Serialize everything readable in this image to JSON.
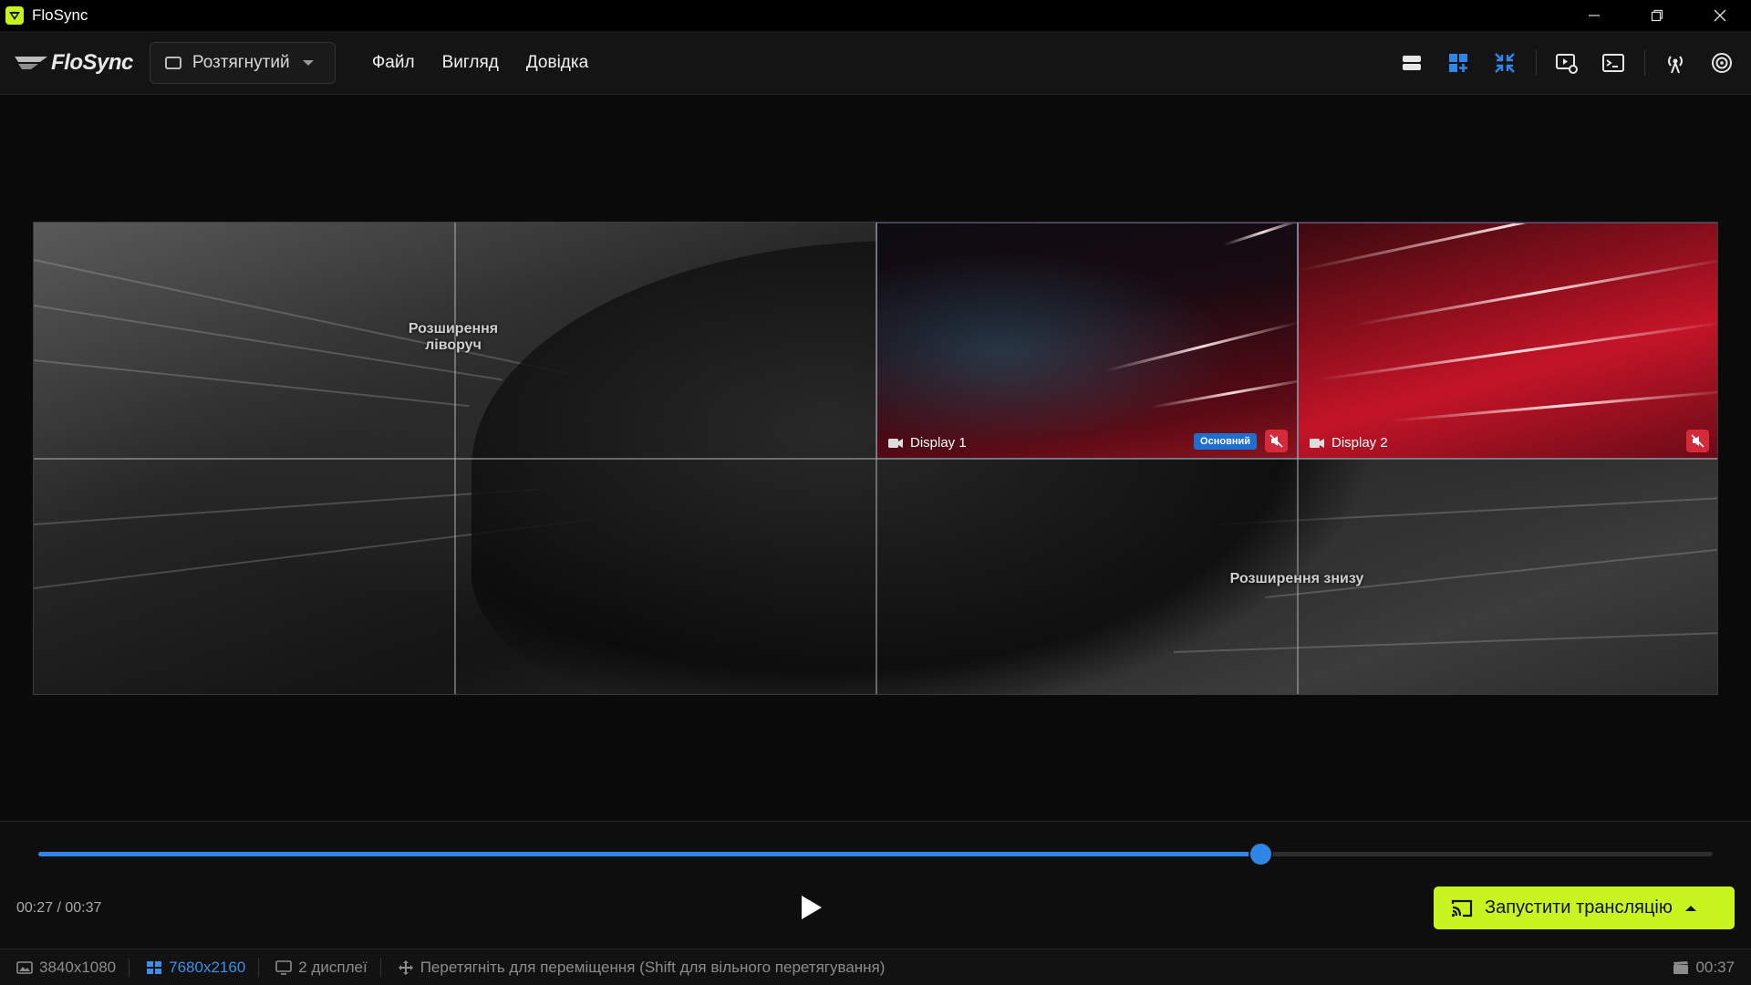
{
  "window": {
    "title": "FloSync",
    "accent_color": "#c8f520"
  },
  "toolbar": {
    "logo_text": "FloSync",
    "mode_label": "Розтягнутий",
    "menu": [
      "Файл",
      "Вигляд",
      "Довідка"
    ],
    "tool_icons": [
      "single-view-icon",
      "grid-view-icon",
      "collapse-icon",
      "preview-settings-icon",
      "terminal-icon",
      "broadcast-icon",
      "airplay-icon"
    ]
  },
  "canvas": {
    "display1_label": "Display 1",
    "display2_label": "Display 2",
    "primary_badge": "Основний",
    "ext_left_line1": "Розширення",
    "ext_left_line2": "ліворуч",
    "ext_bottom": "Розширення знизу"
  },
  "playback": {
    "time": "00:27 / 00:37",
    "progress_fraction": 0.73,
    "cast_label": "Запустити трансляцію"
  },
  "statusbar": {
    "res1": "3840x1080",
    "res2": "7680x2160",
    "displays": "2 дисплеї",
    "hint": "Перетягніть для переміщення (Shift для вільного перетягування)",
    "duration": "00:37"
  }
}
